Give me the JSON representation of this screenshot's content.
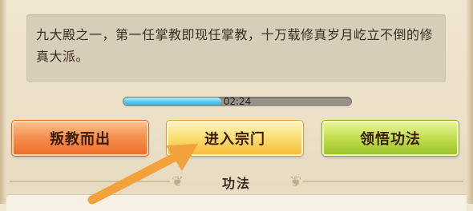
{
  "description": "九大殿之一，第一任掌教即现任掌教，十万载修真岁月屹立不倒的修真大派。",
  "timer": {
    "text": "02:24",
    "progress": 0.43
  },
  "buttons": {
    "rebel": "叛教而出",
    "enter": "进入宗门",
    "comprehend": "领悟功法"
  },
  "section": {
    "title": "功法"
  },
  "colors": {
    "arrow": "#f2a23a",
    "timer_fill": "#35b1de"
  }
}
